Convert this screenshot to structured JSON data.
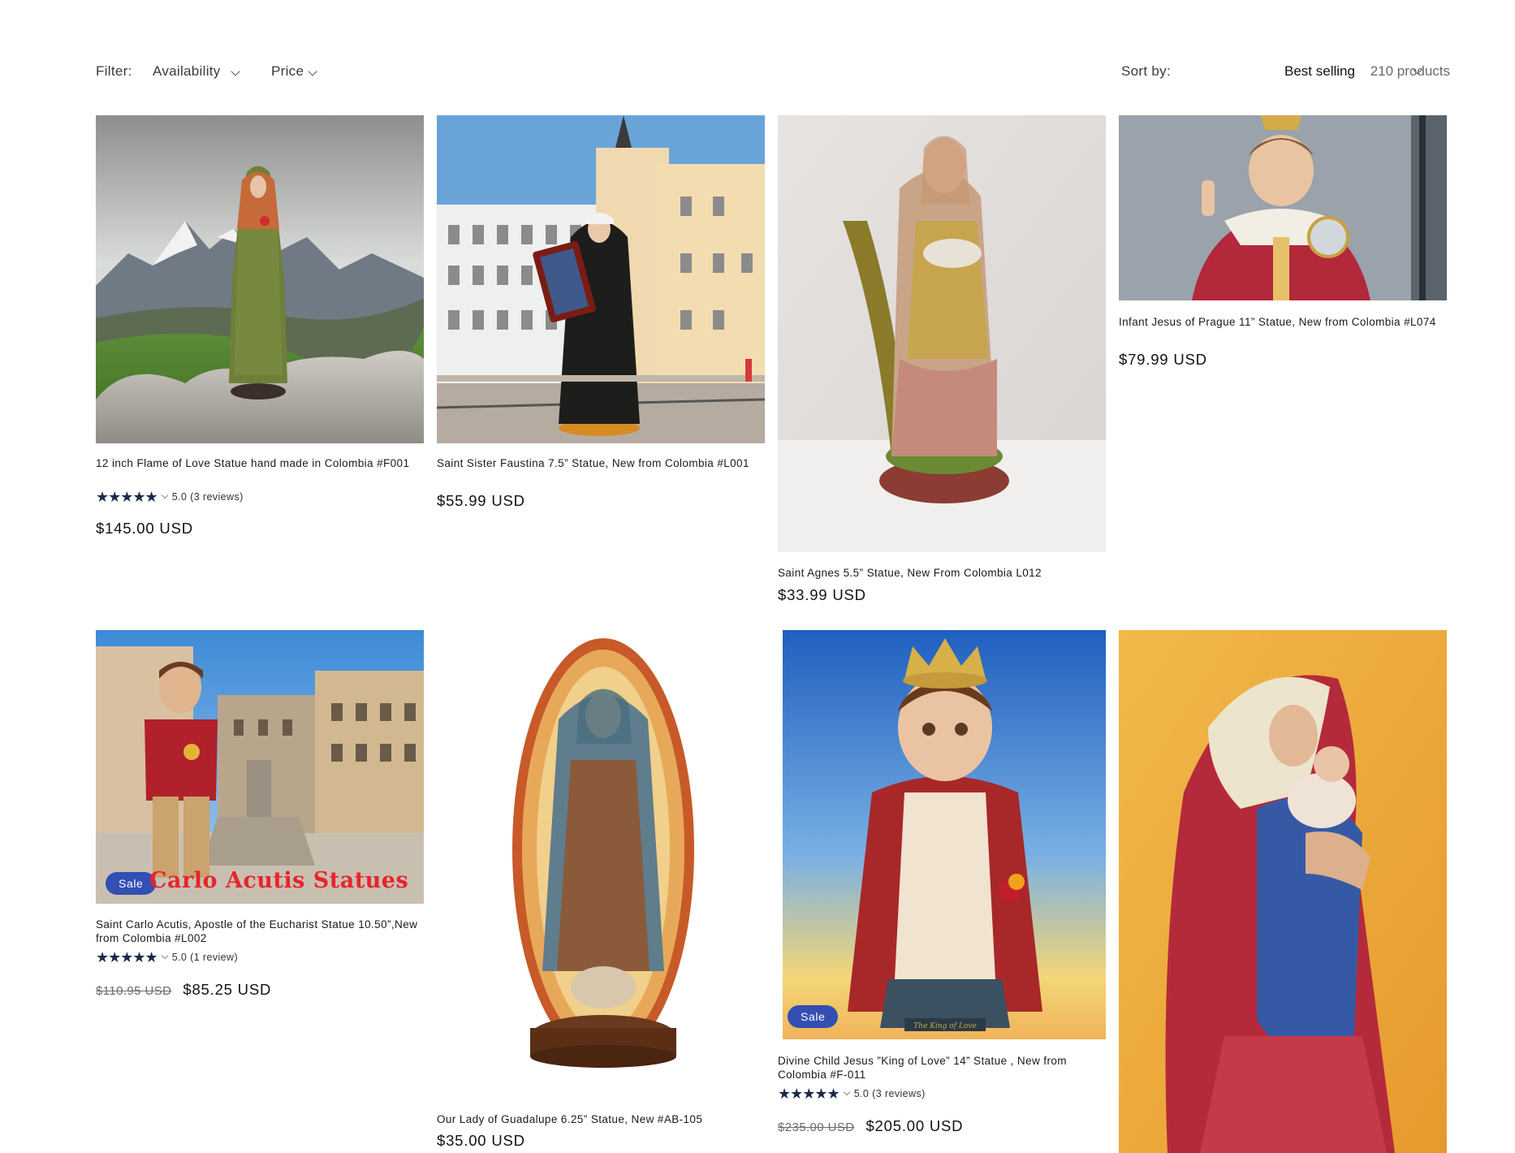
{
  "filter": {
    "label": "Filter:",
    "availability": "Availability",
    "price": "Price"
  },
  "sort": {
    "label": "Sort by:",
    "value": "Best selling",
    "count": "210 products"
  },
  "products": [
    {
      "title": "12 inch Flame of Love Statue hand made in Colombia #F001",
      "rating": {
        "stars": "★★★★★",
        "score": "5.0 (3 reviews)",
        "value": 5.0
      },
      "price": "$145.00 USD",
      "image": "flame-of-love-statue-image"
    },
    {
      "title": "Saint Sister Faustina 7.5” Statue, New from Colombia #L001",
      "price": "$55.99 USD",
      "image": "sister-faustina-statue-image"
    },
    {
      "title": "Saint Agnes 5.5” Statue, New From Colombia L012",
      "price": "$33.99 USD",
      "image": "saint-agnes-statue-image"
    },
    {
      "title": "Infant Jesus of Prague 11” Statue, New from Colombia #L074",
      "price": "$79.99 USD",
      "image": "infant-jesus-of-prague-image"
    },
    {
      "title": "Saint Carlo Acutis, Apostle of the Eucharist Statue 10.50”,New from Colombia #L002",
      "rating": {
        "stars": "★★★★★",
        "score": "5.0 (1 review)",
        "value": 5.0
      },
      "old_price": "$110.95 USD",
      "price": "$85.25 USD",
      "badge": "Sale",
      "image_caption": "Carlo Acutis Statues",
      "image": "carlo-acutis-statue-image"
    },
    {
      "title": "Our Lady of Guadalupe 6.25” Statue, New #AB-105",
      "price": "$35.00 USD",
      "image": "our-lady-of-guadalupe-image"
    },
    {
      "title": "Divine Child Jesus ”King of Love” 14” Statue , New from Colombia #F-011",
      "rating": {
        "stars": "★★★★★",
        "score": "5.0 (3 reviews)",
        "value": 5.0
      },
      "old_price": "$235.00 USD",
      "price": "$205.00 USD",
      "badge": "Sale",
      "image_caption": "The King of Love",
      "image": "divine-child-jesus-image"
    },
    {
      "title": "",
      "price": "",
      "image": "madonna-and-child-image"
    }
  ],
  "colors": {
    "sale_badge": "#334fb4",
    "stars": "#1b2a4a",
    "caption_red": "#e8242b"
  }
}
